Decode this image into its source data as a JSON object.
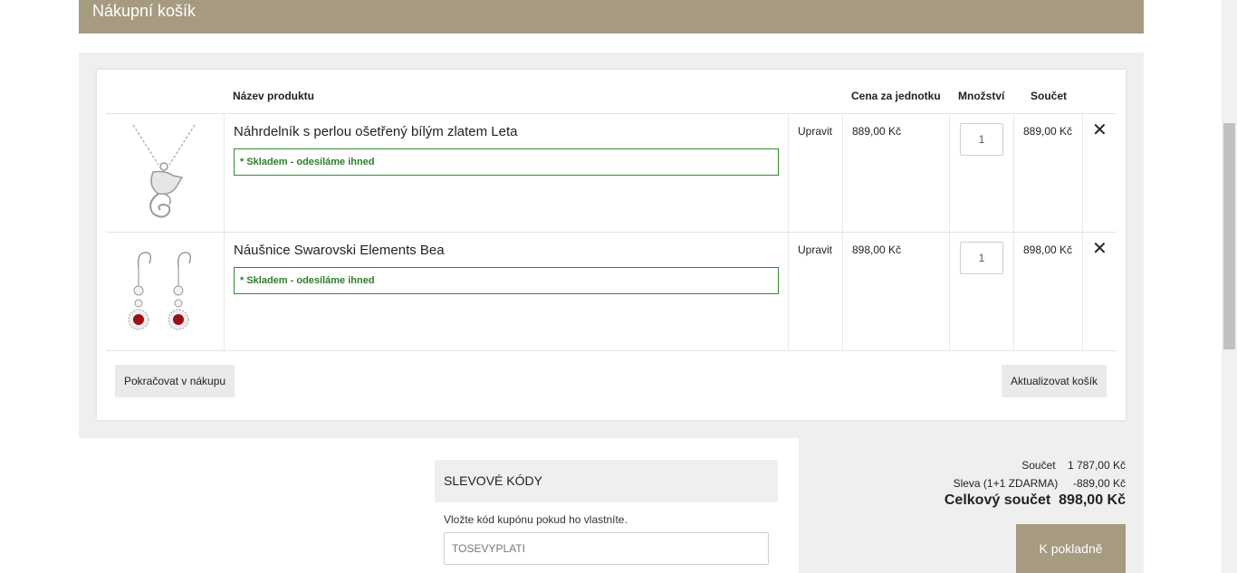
{
  "header": {
    "title": "Nákupní košík"
  },
  "table": {
    "columns": {
      "name": "Název produktu",
      "unit_price": "Cena za jednotku",
      "quantity": "Množství",
      "total": "Součet"
    },
    "rows": [
      {
        "name": "Náhrdelník s perlou ošetřený bílým zlatem Leta",
        "stock": "* Skladem - odesíláme ihned",
        "edit": "Upravit",
        "unit_price": "889,00 Kč",
        "quantity": "1",
        "total": "889,00 Kč",
        "remove": "✕"
      },
      {
        "name": "Náušnice Swarovski Elements Bea",
        "stock": "* Skladem - odesíláme ihned",
        "edit": "Upravit",
        "unit_price": "898,00 Kč",
        "quantity": "1",
        "total": "898,00 Kč",
        "remove": "✕"
      }
    ]
  },
  "actions": {
    "continue": "Pokračovat v nákupu",
    "update": "Aktualizovat košík"
  },
  "coupon": {
    "title": "SLEVOVÉ KÓDY",
    "hint": "Vložte kód kupónu pokud ho vlastníte.",
    "value": "TOSEVYPLATI"
  },
  "totals": {
    "subtotal_label": "Součet",
    "subtotal_value": "1 787,00 Kč",
    "discount_label": "Sleva (1+1 ZDARMA)",
    "discount_value": "-889,00 Kč",
    "grand_label": "Celkový součet",
    "grand_value": "898,00 Kč",
    "checkout": "K pokladně"
  },
  "colors": {
    "accent": "#a69a80",
    "stock_green": "#2e7d2e",
    "panel_grey": "#efefef"
  }
}
